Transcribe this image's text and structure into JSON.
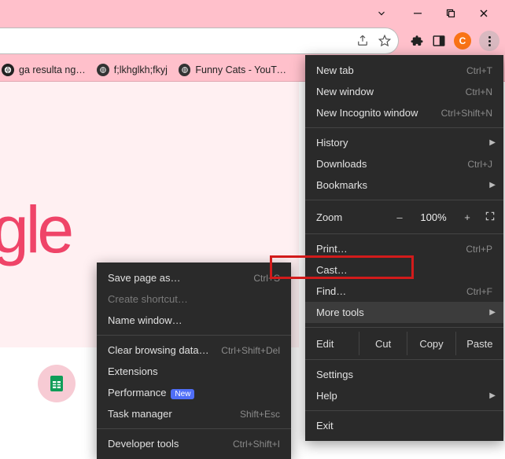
{
  "window": {
    "minimize": "–",
    "maximize": "❐",
    "close": "✕"
  },
  "toolbar": {
    "avatar_initial": "C"
  },
  "bookmarks": [
    {
      "label": "ga resulta ng…"
    },
    {
      "label": "f;lkhglkh;fkyj"
    },
    {
      "label": "Funny Cats - YouTu…"
    }
  ],
  "logo_fragment": "gle",
  "menu": {
    "new_tab": {
      "label": "New tab",
      "shortcut": "Ctrl+T"
    },
    "new_window": {
      "label": "New window",
      "shortcut": "Ctrl+N"
    },
    "new_incognito": {
      "label": "New Incognito window",
      "shortcut": "Ctrl+Shift+N"
    },
    "history": {
      "label": "History"
    },
    "downloads": {
      "label": "Downloads",
      "shortcut": "Ctrl+J"
    },
    "bookmarks": {
      "label": "Bookmarks"
    },
    "zoom": {
      "label": "Zoom",
      "pct": "100%",
      "minus": "–",
      "plus": "+"
    },
    "print": {
      "label": "Print…",
      "shortcut": "Ctrl+P"
    },
    "cast": {
      "label": "Cast…"
    },
    "find": {
      "label": "Find…",
      "shortcut": "Ctrl+F"
    },
    "more_tools": {
      "label": "More tools"
    },
    "edit": {
      "label": "Edit",
      "cut": "Cut",
      "copy": "Copy",
      "paste": "Paste"
    },
    "settings": {
      "label": "Settings"
    },
    "help": {
      "label": "Help"
    },
    "exit": {
      "label": "Exit"
    }
  },
  "submenu": {
    "save_page": {
      "label": "Save page as…",
      "shortcut": "Ctrl+S"
    },
    "create_shortcut": {
      "label": "Create shortcut…"
    },
    "name_window": {
      "label": "Name window…"
    },
    "clear_browsing": {
      "label": "Clear browsing data…",
      "shortcut": "Ctrl+Shift+Del"
    },
    "extensions": {
      "label": "Extensions"
    },
    "performance": {
      "label": "Performance",
      "badge": "New"
    },
    "task_manager": {
      "label": "Task manager",
      "shortcut": "Shift+Esc"
    },
    "developer_tools": {
      "label": "Developer tools",
      "shortcut": "Ctrl+Shift+I"
    }
  }
}
